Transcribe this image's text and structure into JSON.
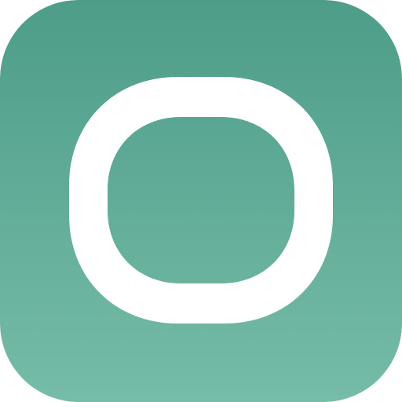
{
  "app_icon": {
    "icon": "rounded-square-ring-icon",
    "colors": {
      "gradient_top": "#4d9d89",
      "gradient_bottom": "#76bca8",
      "glyph": "#ffffff"
    }
  }
}
